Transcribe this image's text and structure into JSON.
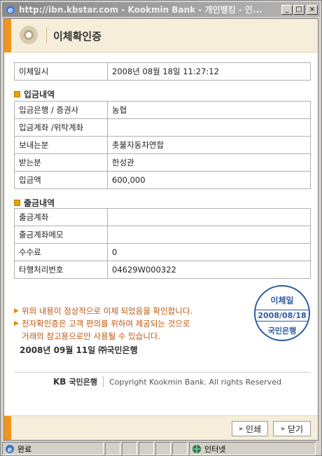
{
  "window": {
    "title": "http://ibn.kbstar.com - Kookmin Bank - 개인뱅킹 - 인..."
  },
  "header": {
    "title": "이체확인증"
  },
  "transfer_time": {
    "label": "이체일시",
    "value": "2008년 08월 18일 11:27:12"
  },
  "deposit": {
    "section_title": "입금내역",
    "rows": [
      {
        "label": "입금은행 / 증권사",
        "value": "농협"
      },
      {
        "label": "입금계좌 /위탁계좌",
        "value": ""
      },
      {
        "label": "보내는분",
        "value": "촛불자동차연합"
      },
      {
        "label": "받는분",
        "value": "한성관"
      },
      {
        "label": "입금액",
        "value": "600,000"
      }
    ]
  },
  "withdrawal": {
    "section_title": "출금내역",
    "rows": [
      {
        "label": "출금계좌",
        "value": ""
      },
      {
        "label": "출금계좌메모",
        "value": ""
      },
      {
        "label": "수수료",
        "value": "0"
      },
      {
        "label": "타행처리번호",
        "value": "04629W000322"
      }
    ]
  },
  "notes": {
    "line1": "위의 내용이 정상적으로 이체 되었음을 확인합니다.",
    "line2": "전자확인증은 고객 편의를 위하여 제공되는 것으로",
    "line3": "거래의 참고용으로만 사용될 수 있습니다."
  },
  "issue_date": "2008년 09월 11일 ㈜국민은행",
  "stamp": {
    "top": "이체일",
    "date": "2008/08/18",
    "bank": "국민은행"
  },
  "footer": {
    "logo_kb": "KB",
    "logo_name": "국민은행",
    "copyright": "Copyright Kookmin Bank. All rights Reserved"
  },
  "buttons": {
    "print": "인쇄",
    "close": "닫기"
  },
  "statusbar": {
    "status": "완료",
    "zone": "인터넷"
  },
  "colors": {
    "accent": "#f0961e",
    "stamp": "#2c5aa0",
    "note_text": "#c0550a"
  }
}
